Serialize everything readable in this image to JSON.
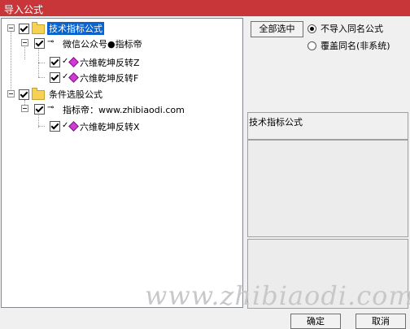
{
  "window": {
    "title": "导入公式"
  },
  "tree": {
    "nodes": [
      {
        "label": "技术指标公式",
        "checked": true,
        "kind": "folder",
        "selected": true
      },
      {
        "label": "微信公众号●指标帝",
        "checked": true,
        "kind": "key"
      },
      {
        "label": "六维乾坤反转Z",
        "checked": true,
        "kind": "formula"
      },
      {
        "label": "六维乾坤反转F",
        "checked": true,
        "kind": "formula"
      },
      {
        "label": "条件选股公式",
        "checked": true,
        "kind": "folder"
      },
      {
        "label": "指标帝：www.zhibiaodi.com",
        "checked": true,
        "kind": "key"
      },
      {
        "label": "六维乾坤反转X",
        "checked": true,
        "kind": "formula"
      }
    ]
  },
  "options": {
    "select_all_label": "全部选中",
    "radio_skip_label": "不导入同名公式",
    "radio_overwrite_label": "覆盖同名(非系统)",
    "selected_radio": "skip"
  },
  "info": {
    "caption": "技术指标公式"
  },
  "footer": {
    "ok_label": "确定",
    "cancel_label": "取消"
  },
  "watermark": {
    "text": "www.zhibiaodi.com"
  },
  "colors": {
    "titlebar": "#c8363a",
    "selection": "#0a64d0",
    "folder": "#f7d154",
    "formula_icon": "#d23ad8"
  }
}
